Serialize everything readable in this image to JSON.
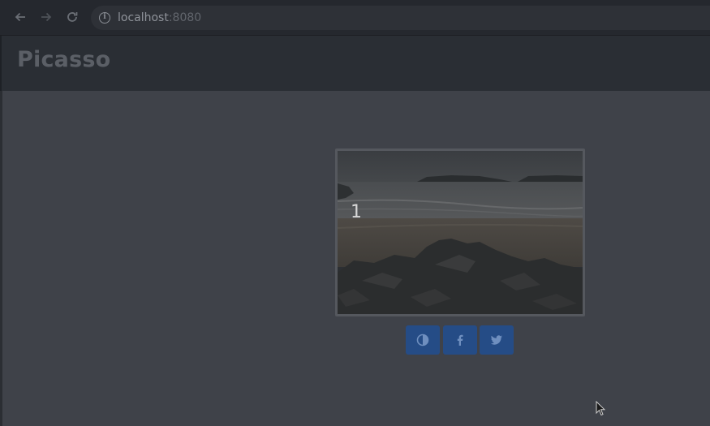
{
  "browser": {
    "url_host": "localhost",
    "url_port": ":8080",
    "back_icon": "arrow-left-icon",
    "forward_icon": "arrow-right-icon",
    "reload_icon": "reload-icon",
    "info_icon": "info-icon"
  },
  "header": {
    "title": "Picasso"
  },
  "photo": {
    "index_label": "1"
  },
  "actions": [
    {
      "icon": "contrast-icon"
    },
    {
      "icon": "facebook-icon"
    },
    {
      "icon": "twitter-icon"
    }
  ],
  "colors": {
    "page_background": "#3f4249",
    "header_background": "#2a2e34",
    "button_accent": "#254c86"
  }
}
